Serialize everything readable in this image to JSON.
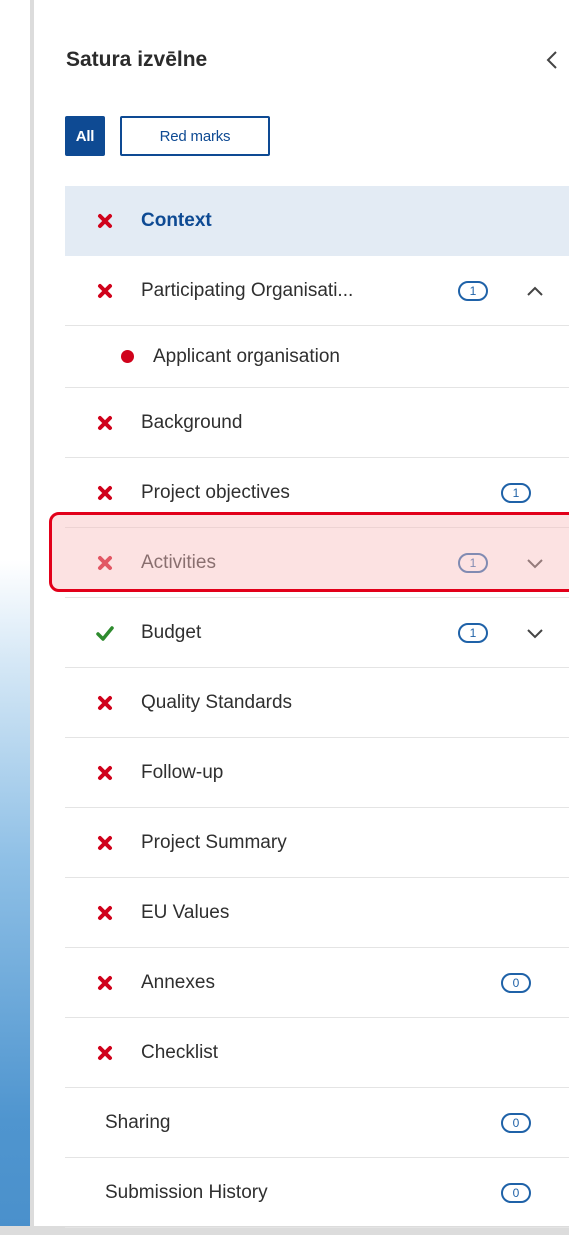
{
  "sidebar": {
    "title": "Satura izvēlne",
    "collapse_icon": "chevron-left-icon",
    "filters": {
      "all_label": "All",
      "red_marks_label": "Red marks",
      "selected": "All"
    },
    "colors": {
      "accent": "#0e4a93",
      "error": "#d0021b",
      "success": "#2e8b2e",
      "highlight": "#e2001a"
    },
    "items": [
      {
        "label": "Context",
        "status": "error",
        "active": true
      },
      {
        "label": "Participating Organisati...",
        "status": "error",
        "badge": "1",
        "expanded": true
      },
      {
        "label": "Applicant organisation",
        "status": "error-dot",
        "sub": true
      },
      {
        "label": "Background",
        "status": "error"
      },
      {
        "label": "Project objectives",
        "status": "error",
        "badge": "1"
      },
      {
        "label": "Activities",
        "status": "error",
        "badge": "1",
        "expanded": false,
        "highlighted": true
      },
      {
        "label": "Budget",
        "status": "ok",
        "badge": "1",
        "expanded": false
      },
      {
        "label": "Quality Standards",
        "status": "error"
      },
      {
        "label": "Follow-up",
        "status": "error"
      },
      {
        "label": "Project Summary",
        "status": "error"
      },
      {
        "label": "EU Values",
        "status": "error"
      },
      {
        "label": "Annexes",
        "status": "error",
        "badge": "0"
      },
      {
        "label": "Checklist",
        "status": "error"
      },
      {
        "label": "Sharing",
        "status": "none",
        "badge": "0"
      },
      {
        "label": "Submission History",
        "status": "none",
        "badge": "0"
      }
    ]
  }
}
